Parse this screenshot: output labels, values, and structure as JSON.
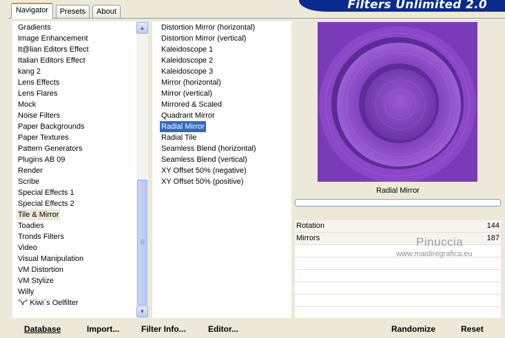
{
  "tabs": [
    {
      "label": "Navigator",
      "active": true
    },
    {
      "label": "Presets",
      "active": false
    },
    {
      "label": "About",
      "active": false
    }
  ],
  "brand_title": "Filters Unlimited 2.0",
  "categories": [
    "Gradients",
    "Image Enhancement",
    "It@lian Editors Effect",
    "Italian Editors Effect",
    "kang 2",
    "Lens Effects",
    "Lens Flares",
    "Mock",
    "Noise Filters",
    "Paper Backgrounds",
    "Paper Textures",
    "Pattern Generators",
    "Plugins AB 09",
    "Render",
    "Scribe",
    "Special Effects 1",
    "Special Effects 2",
    "Tile & Mirror",
    "Toadies",
    "Tronds Filters",
    "Video",
    "Visual Manipulation",
    "VM Distortion",
    "VM Stylize",
    "Willy",
    "°v° Kiwi`s Oelfilter"
  ],
  "selected_category": "Tile & Mirror",
  "filters": [
    "Distortion Mirror (horizontal)",
    "Distortion Mirror (vertical)",
    "Kaleidoscope 1",
    "Kaleidoscope 2",
    "Kaleidoscope 3",
    "Mirror (horizontal)",
    "Mirror (vertical)",
    "Mirrored & Scaled",
    "Quadrant Mirror",
    "Radial Mirror",
    "Radial Tile",
    "Seamless Blend (horizontal)",
    "Seamless Blend (vertical)",
    "XY Offset 50% (negative)",
    "XY Offset 50% (positive)"
  ],
  "selected_filter": "Radial Mirror",
  "preview": {
    "filter_name": "Radial Mirror",
    "colors": {
      "base": "#7a3bb8",
      "light": "#9d5fd6",
      "dark": "#5a2a94"
    }
  },
  "parameters": [
    {
      "label": "Rotation",
      "value": "144"
    },
    {
      "label": "Mirrors",
      "value": "187"
    }
  ],
  "watermark": {
    "name": "Pinuccia",
    "url": "www.maidiregrafica.eu"
  },
  "buttons": {
    "database": "Database",
    "import": "Import...",
    "filter_info": "Filter Info...",
    "editor": "Editor...",
    "randomize": "Randomize",
    "reset": "Reset"
  },
  "icons": {
    "scroll_up": "scroll-up-arrow-icon",
    "scroll_down": "scroll-down-arrow-icon"
  }
}
